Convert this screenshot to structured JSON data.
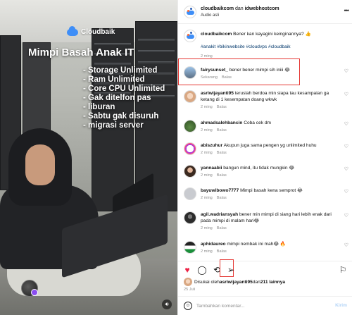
{
  "media": {
    "brand": "Cloudbaik",
    "headline": "Mimpi Basah Anak IT",
    "features": [
      "Storage Unlimited",
      "Ram Unlimited",
      "Core CPU Unlimited",
      "Gak ditelfon pas",
      "liburan",
      "Sabtu gak disuruh",
      "migrasi server"
    ],
    "mute_icon": "speaker-icon"
  },
  "header": {
    "user1": "cloudbaikcom",
    "connector": " dan ",
    "user2": "idwebhostcom",
    "audio": "Audio asli",
    "more_icon": "more-horizontal-icon"
  },
  "caption": {
    "user": "cloudbaikcom",
    "text": " Bener kan kayagini keinginannya? 👍",
    "hashtags": "#anakit #bikinwebsite #cloudvps #cloudbaik",
    "time": "2 ming"
  },
  "comments": [
    {
      "user": "fairysunset_",
      "text": " bener bener mimpi sih iniii 😂",
      "time": "Sekarang",
      "reply": "Balas",
      "highlighted": true
    },
    {
      "user": "asriwijayanti95",
      "text": " teruslah berdoa min siapa tau kesampaian ga ketang di 1 kesempatan doang wkwk",
      "time": "2 ming",
      "reply": "Balas"
    },
    {
      "user": "ahmadsalehbancin",
      "text": " Coba cek dm",
      "time": "2 ming",
      "reply": "Balas"
    },
    {
      "user": "abiszuhur",
      "text": " Akupun juga sama pengen yg unlimited huhu",
      "time": "2 ming",
      "reply": "Balas"
    },
    {
      "user": "yannaabii",
      "text": " bangun mind, itu tidak mungkin 😂",
      "time": "2 ming",
      "reply": "Balas"
    },
    {
      "user": "bayuwibowo7777",
      "text": " Mimpi basah kena semprot 😂",
      "time": "2 ming",
      "reply": "Balas"
    },
    {
      "user": "agil.wadriansyah",
      "text": " bener min mimpi di siang hari lebih enak dari pada mimpi di malam hari😂",
      "time": "2 ming",
      "reply": "Balas"
    },
    {
      "user": "aphidaureo",
      "text": " mimpi nembak ini mah😂 🔥",
      "time": "2 ming",
      "reply": "Balas"
    }
  ],
  "actions": {
    "like_icon": "heart-icon",
    "comment_icon": "comment-icon",
    "repost_icon": "repost-icon",
    "share_icon": "send-icon",
    "save_icon": "bookmark-icon",
    "liked_prefix": "Disukai oleh ",
    "liked_user": "asriwijayanti95",
    "liked_mid": " dan ",
    "liked_count": "211 lainnya",
    "date": "25 Juli"
  },
  "compose": {
    "placeholder": "Tambahkan komentar...",
    "send_label": "Kirim"
  },
  "colors": {
    "accent_blue": "#3e8ef7",
    "like_red": "#ed2145",
    "highlight_red": "#e53935"
  }
}
